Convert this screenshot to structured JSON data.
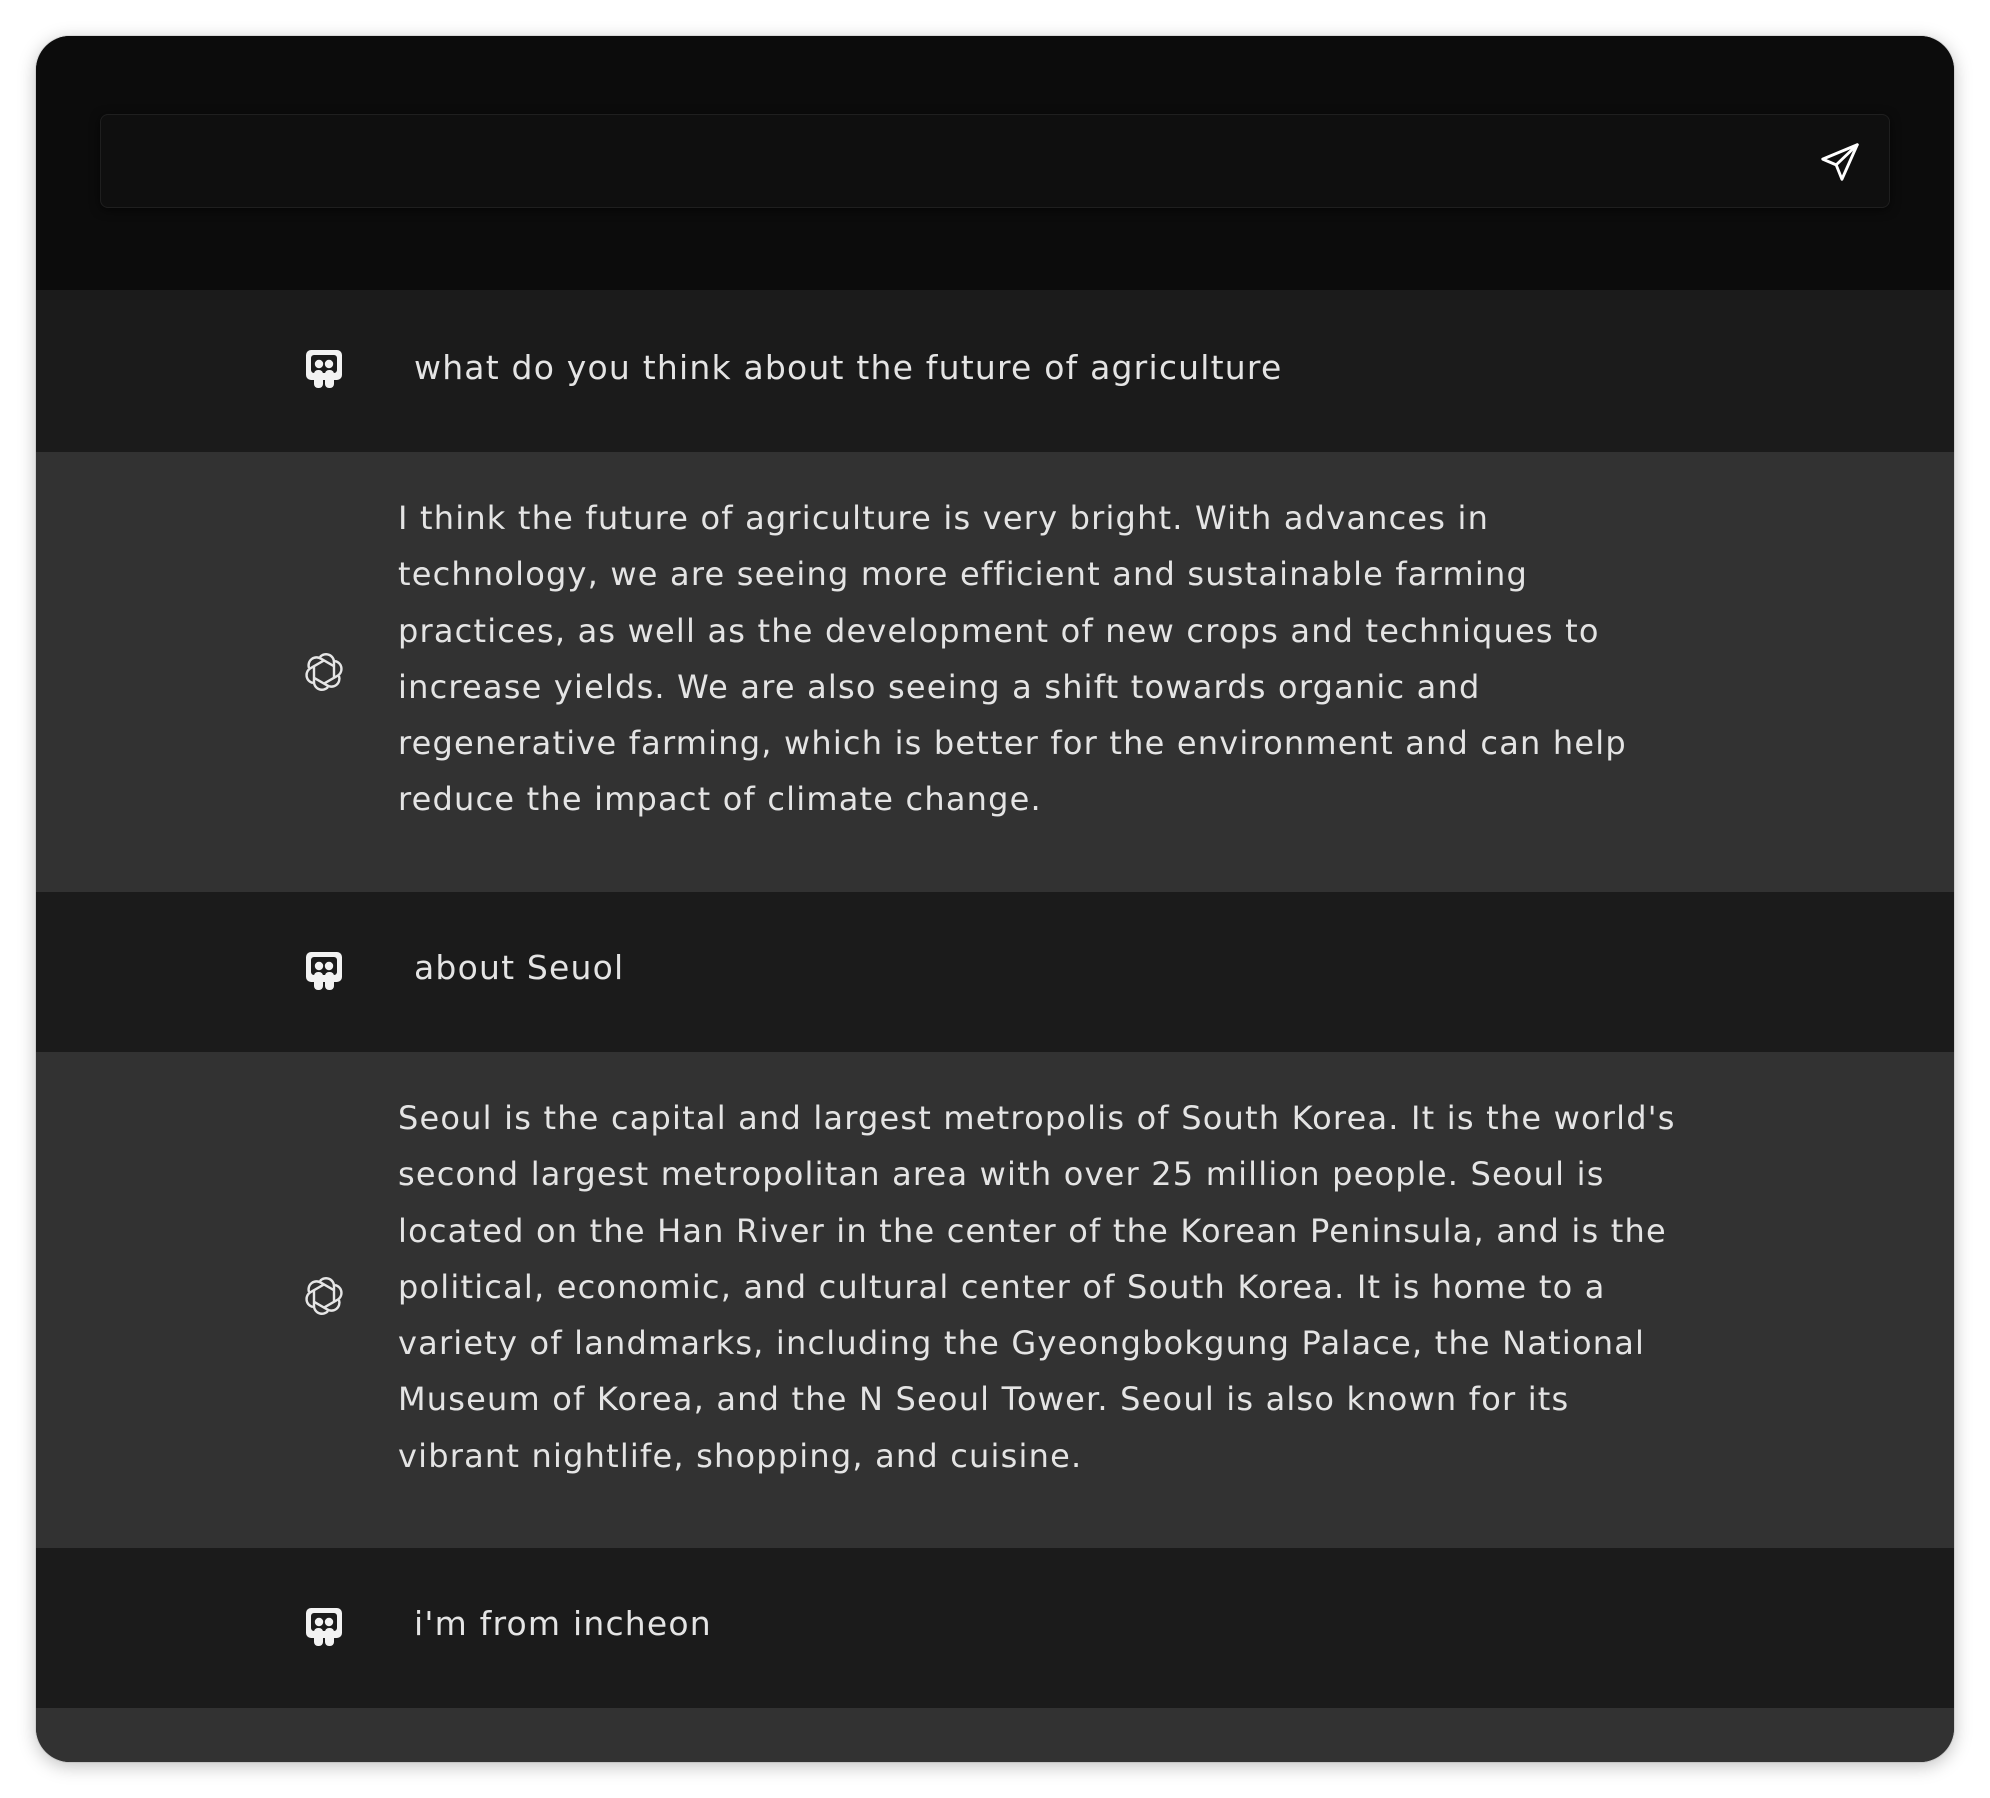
{
  "input": {
    "value": "",
    "placeholder": ""
  },
  "icons": {
    "send": "send-paper-plane-icon",
    "user_avatar": "user-avatar-icon",
    "assistant_avatar": "openai-logo-icon"
  },
  "messages": [
    {
      "role": "user",
      "text": "what do you think about the future of agriculture"
    },
    {
      "role": "assistant",
      "text": "I think the future of agriculture is very bright. With advances in technology, we are seeing more efficient and sustainable farming practices, as well as the development of new crops and techniques to increase yields. We are also seeing a shift towards organic and regenerative farming, which is better for the environment and can help reduce the impact of climate change."
    },
    {
      "role": "user",
      "text": "about Seuol"
    },
    {
      "role": "assistant",
      "text": "Seoul is the capital and largest metropolis of South Korea. It is the world's second largest metropolitan area with over 25 million people. Seoul is located on the Han River in the center of the Korean Peninsula, and is the political, economic, and cultural center of South Korea. It is home to a variety of landmarks, including the Gyeongbokgung Palace, the National Museum of Korea, and the N Seoul Tower. Seoul is also known for its vibrant nightlife, shopping, and cuisine."
    },
    {
      "role": "user",
      "text": "i'm from incheon"
    }
  ],
  "colors": {
    "window_bg": "#0b0b0b",
    "user_row_bg": "#1b1b1b",
    "assistant_row_bg": "#323232",
    "text": "#e4e4e4"
  }
}
